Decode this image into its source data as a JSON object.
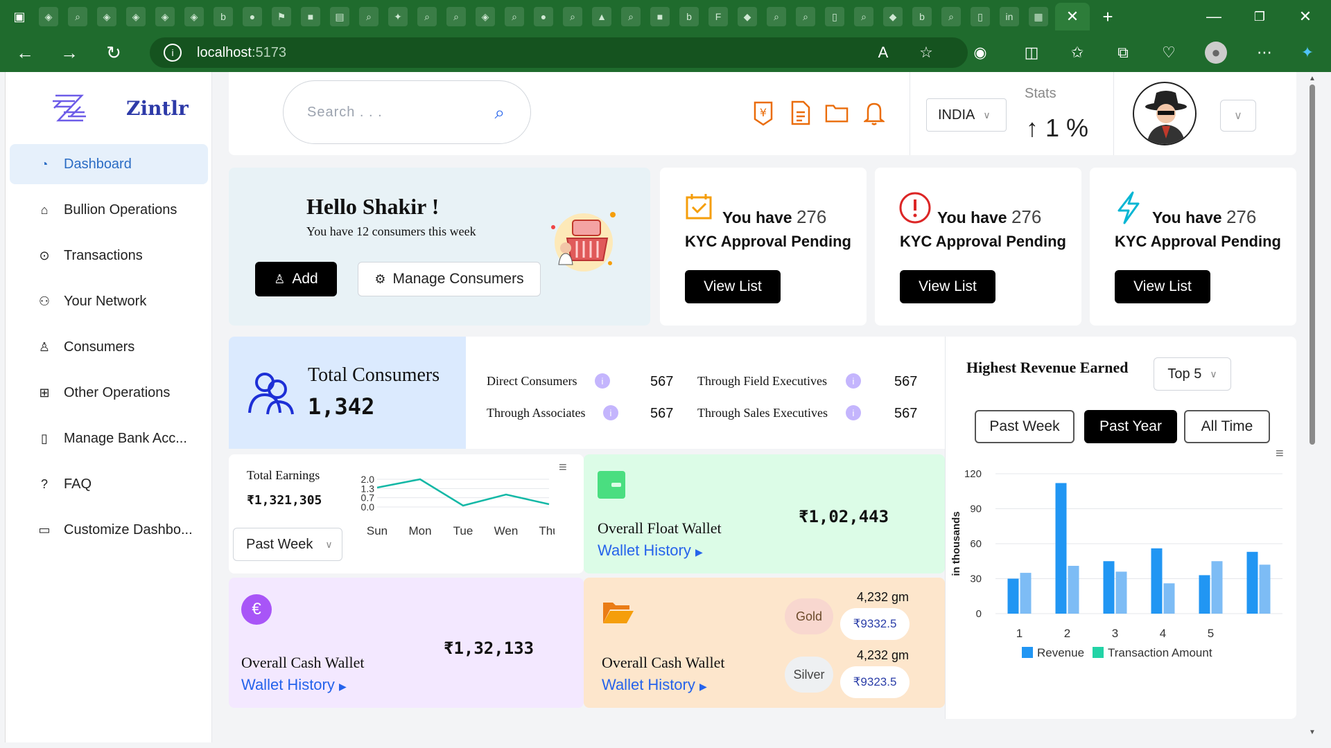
{
  "browser": {
    "url_host": "localhost",
    "url_port": ":5173"
  },
  "app": {
    "name": "Zintlr"
  },
  "sidebar": {
    "items": [
      {
        "label": "Dashboard",
        "icon": "dashboard-icon"
      },
      {
        "label": "Bullion Operations",
        "icon": "bank-icon"
      },
      {
        "label": "Transactions",
        "icon": "transactions-icon"
      },
      {
        "label": "Your Network",
        "icon": "network-icon"
      },
      {
        "label": "Consumers",
        "icon": "user-icon"
      },
      {
        "label": "Other Operations",
        "icon": "grid-icon"
      },
      {
        "label": "Manage Bank Acc...",
        "icon": "document-plus-icon"
      },
      {
        "label": "FAQ",
        "icon": "question-icon"
      },
      {
        "label": "Customize Dashbo...",
        "icon": "video-icon"
      }
    ]
  },
  "header": {
    "search_placeholder": "Search . . .",
    "country": "INDIA",
    "stats_label": "Stats",
    "stats_value": "1 %"
  },
  "greeting": {
    "title": "Hello Shakir !",
    "subtitle": "You have 12 consumers this week",
    "add_label": "Add",
    "manage_label": "Manage Consumers"
  },
  "kyc_cards": [
    {
      "prefix": "You have",
      "count": "276",
      "line2": "KYC Approval Pending",
      "button": "View List",
      "icon": "calendar-check-icon",
      "color": "#f59e0b"
    },
    {
      "prefix": "You have",
      "count": "276",
      "line2": "KYC Approval Pending",
      "button": "View List",
      "icon": "alert-circle-icon",
      "color": "#dc2626"
    },
    {
      "prefix": "You have",
      "count": "276",
      "line2": "KYC Approval Pending",
      "button": "View List",
      "icon": "lightning-icon",
      "color": "#06b6d4"
    }
  ],
  "consumers": {
    "title": "Total Consumers",
    "total": "1,342",
    "breakdown": [
      {
        "label": "Direct Consumers",
        "value": "567"
      },
      {
        "label": "Through Field Executives",
        "value": "567"
      },
      {
        "label": "Through Associates",
        "value": "567"
      },
      {
        "label": "Through Sales Executives",
        "value": "567"
      }
    ]
  },
  "earnings": {
    "title": "Total Earnings",
    "value": "₹1,321,305",
    "period": "Past Week"
  },
  "float_wallet": {
    "title": "Overall Float Wallet",
    "value": "₹1,02,443",
    "link": "Wallet History"
  },
  "cash_wallet": {
    "title": "Overall Cash Wallet",
    "value": "₹1,32,133",
    "link": "Wallet History"
  },
  "metal_wallet": {
    "title": "Overall Cash Wallet",
    "link": "Wallet History",
    "gold_label": "Gold",
    "gold_weight": "4,232 gm",
    "gold_price": "₹9332.5",
    "silver_label": "Silver",
    "silver_weight": "4,232 gm",
    "silver_price": "₹9323.5"
  },
  "revenue": {
    "title": "Highest Revenue Earned",
    "top_select": "Top 5",
    "filters": [
      "Past Week",
      "Past Year",
      "All Time"
    ],
    "active_filter": "Past Year"
  },
  "colors": {
    "primary_blue": "#2b6cc4",
    "accent_orange": "#ea6c0a",
    "browser_green": "#1f6b2d",
    "bar_revenue": "#2196f3",
    "bar_txn": "#7dbcf5",
    "legend_txn": "#22d3a6"
  },
  "chart_data": [
    {
      "type": "line",
      "x": [
        "Sun",
        "Mon",
        "Tue",
        "Wen",
        "Thu"
      ],
      "series": [
        {
          "values": [
            1.4,
            2.0,
            0.1,
            0.9,
            0.2
          ]
        }
      ],
      "ylim": [
        0,
        2.0
      ],
      "yticks": [
        "2.0",
        "1.3",
        "0.7",
        "0.0"
      ],
      "color": "#14b8a6"
    },
    {
      "type": "bar",
      "categories": [
        "1",
        "2",
        "3",
        "4",
        "5",
        ""
      ],
      "series": [
        {
          "name": "Revenue",
          "values": [
            30,
            112,
            45,
            56,
            33,
            53
          ]
        },
        {
          "name": "Transaction Amount",
          "values": [
            35,
            41,
            36,
            26,
            45,
            42
          ]
        }
      ],
      "ylabel": "in thousands",
      "ylim": [
        0,
        120
      ],
      "yticks": [
        "120",
        "90",
        "60",
        "30",
        "0"
      ],
      "legend": "bottom"
    }
  ]
}
